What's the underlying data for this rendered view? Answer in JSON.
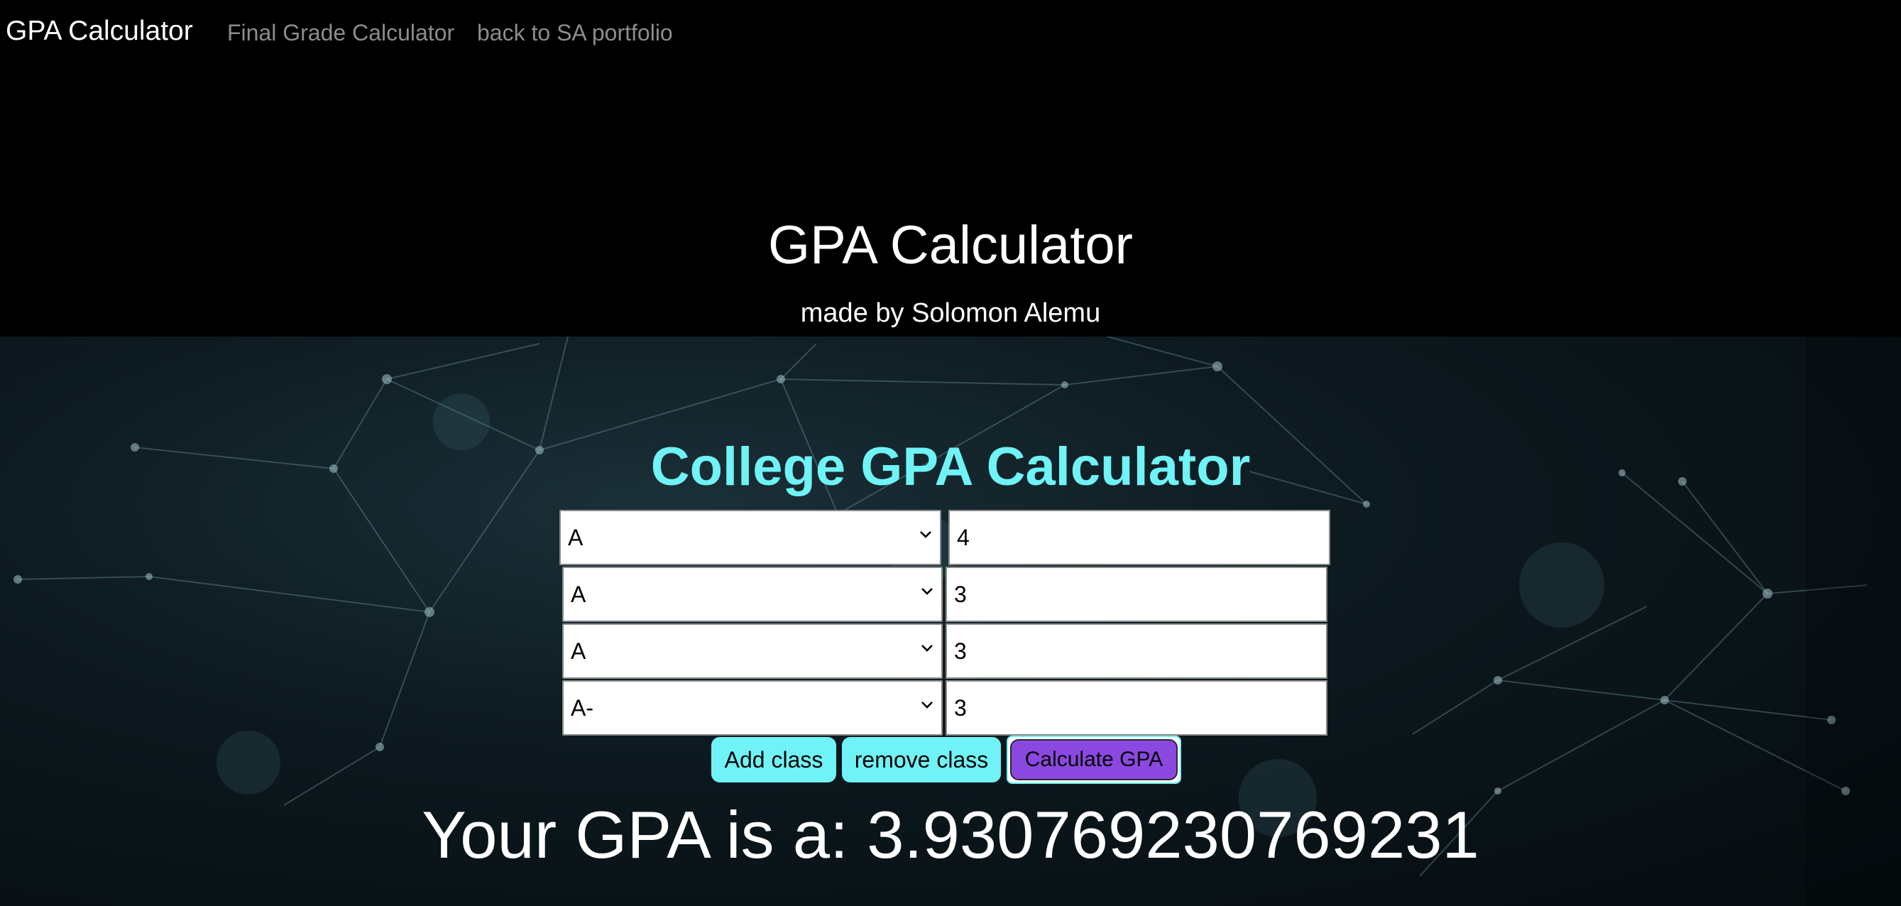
{
  "nav": {
    "brand": "GPA Calculator",
    "links": [
      "Final Grade Calculator",
      "back to SA portfolio"
    ]
  },
  "hero": {
    "title": "GPA Calculator",
    "subtitle": "made by Solomon Alemu"
  },
  "calculator": {
    "title": "College GPA Calculator",
    "rows": [
      {
        "grade": "A",
        "credits": "4"
      },
      {
        "grade": "A",
        "credits": "3"
      },
      {
        "grade": "A",
        "credits": "3"
      },
      {
        "grade": "A-",
        "credits": "3"
      }
    ],
    "buttons": {
      "add": "Add class",
      "remove": "remove class",
      "calculate": "Calculate GPA"
    },
    "result": "Your GPA is a: 3.930769230769231"
  },
  "colors": {
    "accent": "#6ff3f6",
    "calc_button": "#8b48e0",
    "background": "#000000"
  },
  "icons": {
    "select_arrow": "chevron-down-icon"
  }
}
